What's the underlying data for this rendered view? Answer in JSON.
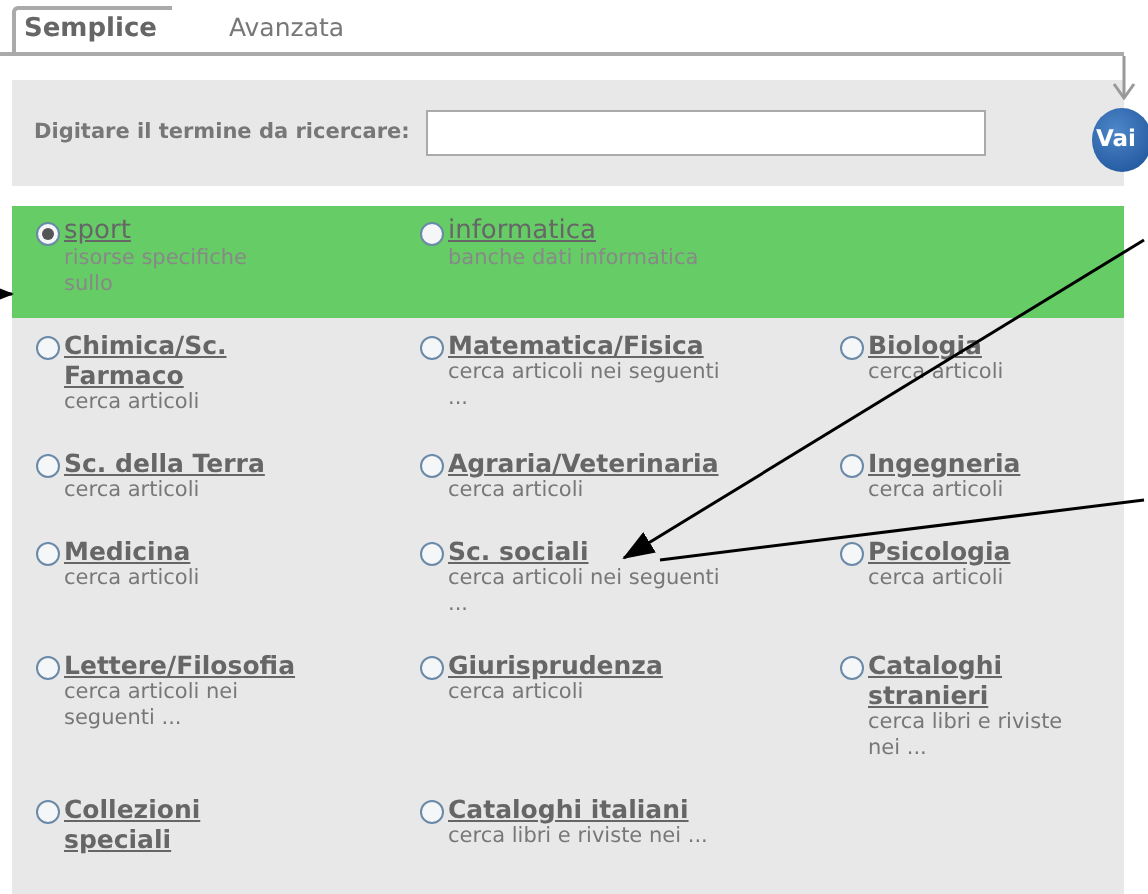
{
  "tabs": [
    {
      "label": "Semplice",
      "selected": true
    },
    {
      "label": "Avanzata",
      "selected": false
    }
  ],
  "search": {
    "label": "Digitare il termine da ricercare:",
    "button": "Vai"
  },
  "featured": [
    {
      "title": "sport",
      "description": "risorse specifiche sullo",
      "selected": true
    },
    {
      "title": "informatica",
      "description": "banche dati informatica",
      "selected": false
    }
  ],
  "categories": [
    {
      "title": "Chimica/Sc. Farmaco",
      "description": "cerca articoli",
      "selected": false
    },
    {
      "title": "Matematica/Fisica",
      "description": "cerca articoli nei seguenti ...",
      "selected": false
    },
    {
      "title": "Biologia",
      "description": "cerca articoli",
      "selected": false
    },
    {
      "title": "Sc. della Terra",
      "description": "cerca articoli",
      "selected": false
    },
    {
      "title": "Agraria/Veterinaria",
      "description": "cerca articoli",
      "selected": false
    },
    {
      "title": "Ingegneria",
      "description": "cerca articoli",
      "selected": false
    },
    {
      "title": "Medicina",
      "description": "cerca articoli",
      "selected": false
    },
    {
      "title": "Sc. sociali",
      "description": "cerca articoli nei seguenti ...",
      "selected": false
    },
    {
      "title": "Psicologia",
      "description": "cerca articoli",
      "selected": false
    },
    {
      "title": "Lettere/Filosofia",
      "description": "cerca articoli nei seguenti ...",
      "selected": false
    },
    {
      "title": "Giurisprudenza",
      "description": "cerca articoli",
      "selected": false
    },
    {
      "title": "Cataloghi stranieri",
      "description": "cerca libri e riviste nei ...",
      "selected": false
    },
    {
      "title": "Collezioni speciali",
      "selected": false
    },
    {
      "title": "Cataloghi italiani",
      "description": "cerca libri e riviste nei ...",
      "selected": false
    }
  ]
}
